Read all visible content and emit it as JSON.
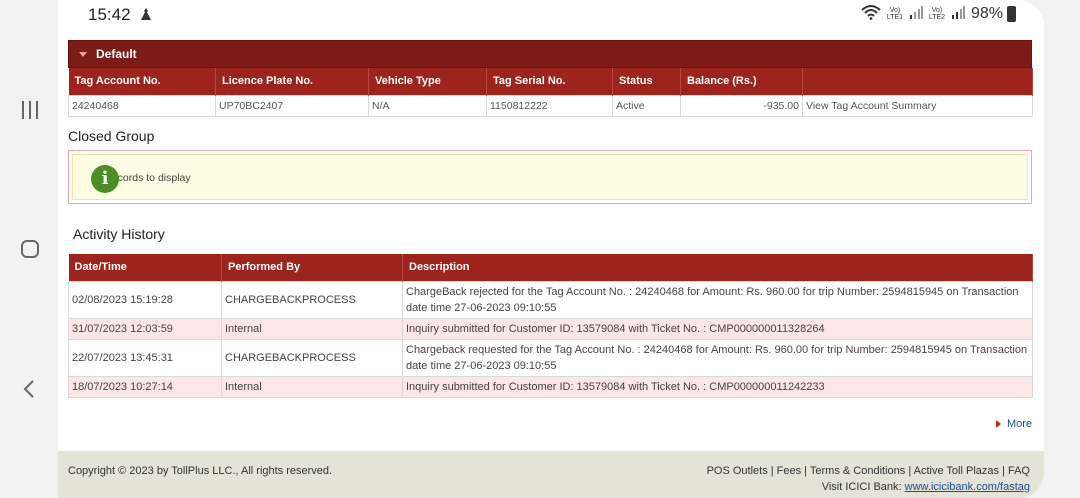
{
  "status_bar": {
    "time": "15:42",
    "sim1": "Vo) LTE1",
    "sim2": "Vo) LTE2",
    "battery": "98%"
  },
  "default_panel": {
    "title": "Default",
    "columns": [
      "Tag Account No.",
      "Licence Plate No.",
      "Vehicle Type",
      "Tag Serial No.",
      "Status",
      "Balance (Rs.)",
      ""
    ],
    "row": {
      "tag_account": "24240468",
      "licence_plate": "UP70BC2407",
      "vehicle_type": "N/A",
      "tag_serial": "1150812222",
      "status": "Active",
      "balance": "-935.00",
      "link": "View Tag Account Summary"
    }
  },
  "closed_group": {
    "title": "Closed Group",
    "empty_message": "No records to display"
  },
  "activity": {
    "title": "Activity History",
    "columns": [
      "Date/Time",
      "Performed By",
      "Description"
    ],
    "rows": [
      {
        "datetime": "02/08/2023 15:19:28",
        "by": "CHARGEBACKPROCESS",
        "description": "ChargeBack rejected for the Tag Account No. : 24240468 for Amount: Rs. 960.00 for trip Number: 2594815945 on Transaction date time 27-06-2023 09:10:55"
      },
      {
        "datetime": "31/07/2023 12:03:59",
        "by": "Internal",
        "description": "Inquiry submitted for Customer ID: 13579084 with Ticket No. : CMP000000011328264"
      },
      {
        "datetime": "22/07/2023 13:45:31",
        "by": "CHARGEBACKPROCESS",
        "description": "Chargeback requested for the Tag Account No. : 24240468 for Amount: Rs. 960.00 for trip Number: 2594815945 on Transaction date time 27-06-2023 09:10:55"
      },
      {
        "datetime": "18/07/2023 10:27:14",
        "by": "Internal",
        "description": "Inquiry submitted for Customer ID: 13579084 with Ticket No. : CMP000000011242233"
      }
    ],
    "more_label": "More"
  },
  "footer": {
    "copyright": "Copyright © 2023 by TollPlus LLC., All rights reserved.",
    "links": "POS Outlets | Fees | Terms & Conditions | Active Toll Plazas | FAQ",
    "visit_prefix": "Visit ICICI Bank:",
    "visit_link": "www.icicibank.com/fastag"
  },
  "icons": {
    "nav_recent": "recent-apps-icon",
    "nav_home": "home-icon",
    "nav_back": "back-icon",
    "info": "info-icon"
  },
  "colors": {
    "header": "#7d1c17",
    "table_header": "#9d241c",
    "alt_row": "#fde6e6",
    "footer": "#e3e3d8"
  }
}
